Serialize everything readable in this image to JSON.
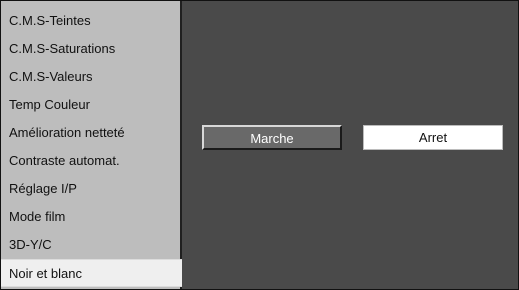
{
  "menu": {
    "items": [
      {
        "label": "C.M.S-Teintes"
      },
      {
        "label": "C.M.S-Saturations"
      },
      {
        "label": "C.M.S-Valeurs"
      },
      {
        "label": "Temp Couleur"
      },
      {
        "label": "Amélioration netteté"
      },
      {
        "label": "Contraste automat."
      },
      {
        "label": "Réglage I/P"
      },
      {
        "label": "Mode film"
      },
      {
        "label": "3D-Y/C"
      },
      {
        "label": "Noir et blanc"
      }
    ],
    "selected_label": "Noir et blanc"
  },
  "options": {
    "on_label": "Marche",
    "off_label": "Arret",
    "selected": "Marche"
  },
  "colors": {
    "menu_background": "#bdbdbd",
    "menu_selected_background": "#efefef",
    "panel_background": "#4a4a4a",
    "active_button": "#696969",
    "inactive_button": "#ffffff"
  }
}
